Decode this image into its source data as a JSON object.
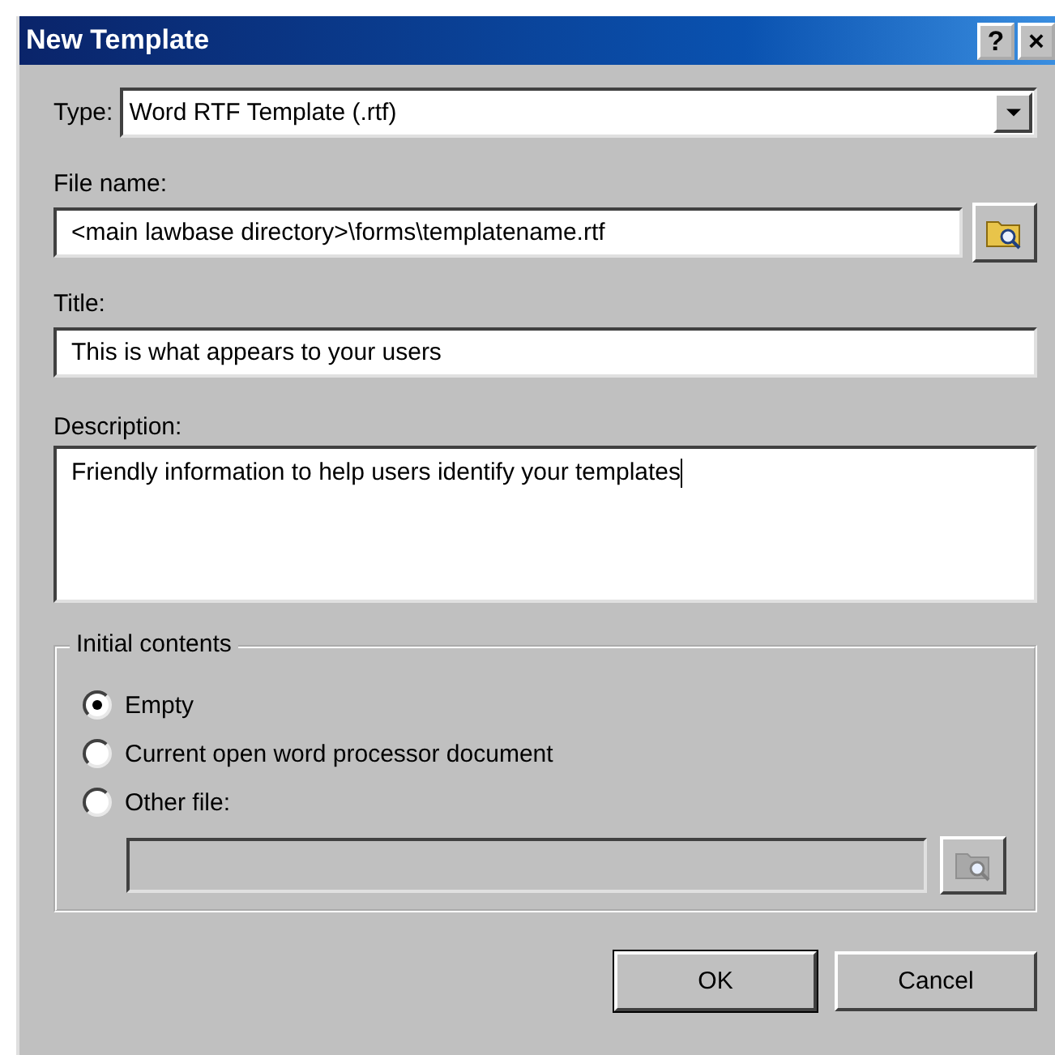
{
  "window": {
    "title": "New Template",
    "title_buttons": [
      "?",
      "×"
    ]
  },
  "type": {
    "label": "Type:",
    "value": "Word RTF Template (.rtf)"
  },
  "file_name": {
    "label": "File name:",
    "value": "<main lawbase directory>\\forms\\templatename.rtf"
  },
  "title": {
    "label": "Title:",
    "value": "This is what appears to your users"
  },
  "description": {
    "label": "Description:",
    "value": "Friendly information to help users identify your templates"
  },
  "initial_contents": {
    "legend": "Initial contents",
    "options": [
      {
        "label": "Empty",
        "selected": true
      },
      {
        "label": "Current open word processor document",
        "selected": false
      },
      {
        "label": "Other file:",
        "selected": false
      }
    ],
    "other_file": {
      "disabled": true
    }
  },
  "buttons": [
    "OK",
    "Cancel"
  ]
}
